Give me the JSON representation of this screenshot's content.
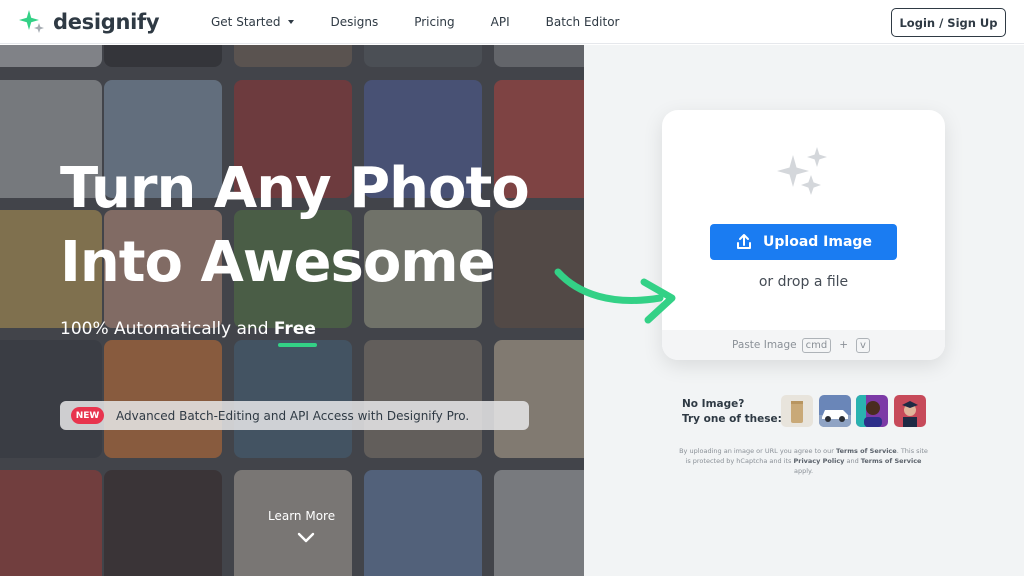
{
  "brand": {
    "name": "designify",
    "accent": "#33d186",
    "primary": "#1a7cf2"
  },
  "nav": {
    "links": [
      {
        "label": "Get Started",
        "has_dropdown": true
      },
      {
        "label": "Designs"
      },
      {
        "label": "Pricing"
      },
      {
        "label": "API"
      },
      {
        "label": "Batch Editor"
      }
    ],
    "login_label": "Login / Sign Up"
  },
  "hero": {
    "title_line1": "Turn Any Photo",
    "title_line2": "Into Awesome",
    "subtitle_prefix": "100% Automatically and ",
    "subtitle_emphasis": "Free",
    "promo_badge": "NEW",
    "promo_text": "Advanced Batch-Editing and API Access with Designify Pro.",
    "learn_more": "Learn More"
  },
  "upload": {
    "button_label": "Upload Image",
    "drop_text": "or drop a file",
    "paste_label": "Paste Image",
    "key_cmd": "cmd",
    "key_plus": "+",
    "key_v": "v"
  },
  "samples": {
    "line1": "No Image?",
    "line2": "Try one of these:"
  },
  "legal": {
    "t1": "By uploading an image or URL you agree to our ",
    "tos": "Terms of Service",
    "t2": ". This site is protected by hCaptcha and its ",
    "privacy": "Privacy Policy",
    "t3": " and ",
    "tos2": "Terms of Service",
    "t4": " apply."
  }
}
